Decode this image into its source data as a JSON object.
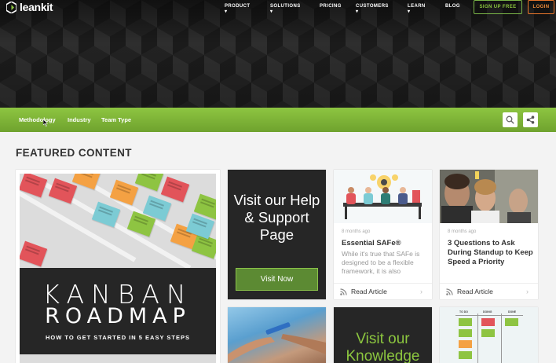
{
  "brand": {
    "name": "leankit"
  },
  "nav": {
    "items": [
      "PRODUCT ▾",
      "SOLUTIONS ▾",
      "PRICING",
      "CUSTOMERS ▾",
      "LEARN ▾",
      "BLOG"
    ],
    "signup": "SIGN UP FREE",
    "login": "LOGIN"
  },
  "subnav": {
    "items": [
      "Methodology",
      "Industry",
      "Team Type"
    ]
  },
  "icons": {
    "search": "search-icon",
    "share": "share-icon"
  },
  "section": {
    "title": "FEATURED CONTENT"
  },
  "cards": {
    "kanban": {
      "line1": "KANBAN",
      "line2": "ROADMAP",
      "line3": "HOW TO GET STARTED IN 5 EASY STEPS"
    },
    "help": {
      "text": "Visit our Help & Support Page",
      "button": "Visit Now"
    },
    "article1": {
      "date": "8 months ago",
      "title": "Essential SAFe®",
      "excerpt": "While it's true that SAFe is designed to be a flexible framework, it is also",
      "link": "Read Article"
    },
    "article2": {
      "date": "8 months ago",
      "title": "3 Questions to Ask During Standup to Keep Speed a Priority",
      "link": "Read Article"
    },
    "knowledge": {
      "text": "Visit our Knowledge"
    },
    "board": {
      "cols": [
        "TO DO",
        "DOING",
        "DONE"
      ]
    }
  },
  "colors": {
    "green": "#8dc541",
    "orange": "#e8762b",
    "dark": "#262626",
    "button_green": "#5c8a33"
  }
}
